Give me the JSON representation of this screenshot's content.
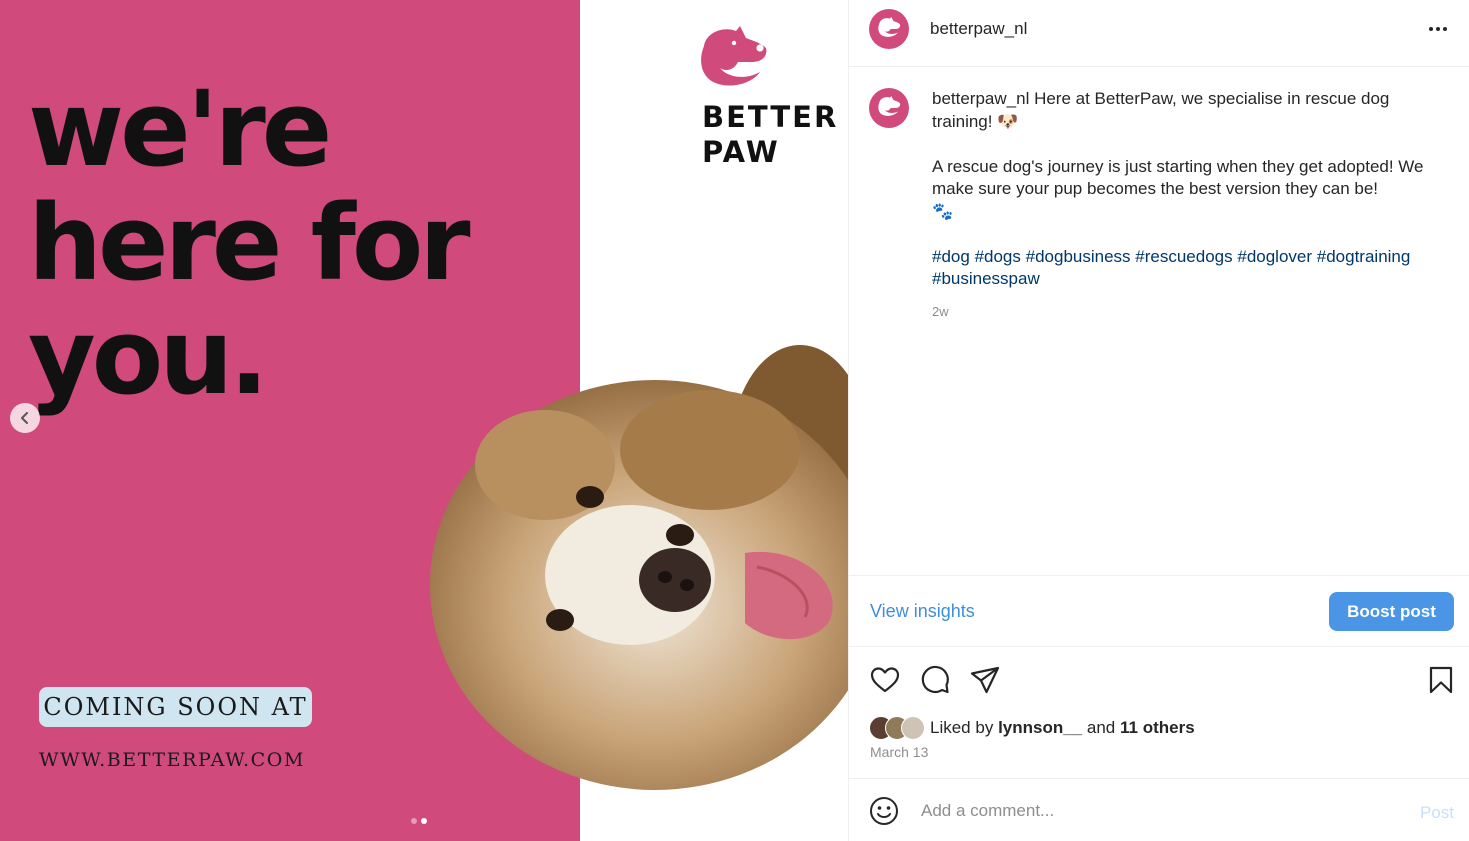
{
  "post_image": {
    "headline_lines": [
      "we're",
      "here for",
      "you."
    ],
    "coming_soon": "COMING SOON AT",
    "website": "WWW.BETTERPAW.COM",
    "brand_lines": [
      "BETTER",
      "PAW"
    ],
    "slide_count": 2,
    "active_slide": 2,
    "colors": {
      "background": "#d14a7c",
      "badge": "#cfe5ef"
    }
  },
  "header": {
    "username": "betterpaw_nl",
    "more_icon": "more-horizontal-icon"
  },
  "caption": {
    "username": "betterpaw_nl",
    "line1": "Here at BetterPaw, we specialise in rescue dog training!",
    "line1_emoji": "🐶",
    "paragraph2": "A rescue dog's journey is just starting when they get adopted! We make sure your pup becomes the best version they can be!",
    "paragraph2_emoji": "🐾",
    "hashtags": [
      "#dog",
      "#dogs",
      "#dogbusiness",
      "#rescuedogs",
      "#doglover",
      "#dogtraining",
      "#businesspaw"
    ],
    "time_ago": "2w"
  },
  "insights": {
    "view_label": "View insights",
    "boost_label": "Boost post",
    "boost_color": "#4a95e6"
  },
  "actions": {
    "icons": [
      "heart-icon",
      "comment-icon",
      "share-icon",
      "bookmark-icon"
    ]
  },
  "likes": {
    "prefix": "Liked by",
    "first_user": "lynnson__",
    "joiner": "and",
    "others": "11 others"
  },
  "date": "March 13",
  "comment": {
    "placeholder": "Add a comment...",
    "post_label": "Post"
  }
}
